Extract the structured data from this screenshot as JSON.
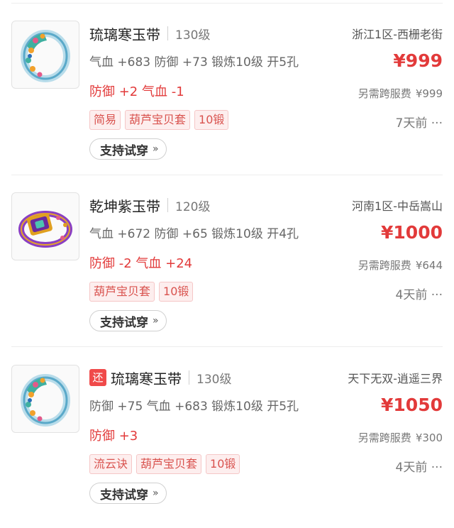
{
  "listings": [
    {
      "return_tag": "",
      "name": "琉璃寒玉带",
      "level": "130级",
      "server": "浙江1区-西栅老街",
      "stats": "气血 +683 防御 +73 锻炼10级 开5孔",
      "price": "¥999",
      "effect": "防御 +2 气血 -1",
      "fee_label": "另需跨服费",
      "fee_amount": "¥999",
      "tags": [
        "简易",
        "葫芦宝贝套",
        "10锻"
      ],
      "time": "7天前",
      "more": "···",
      "try_label": "支持试穿",
      "try_chevron": "»",
      "ring_icon": "blue-jade-ring-icon"
    },
    {
      "return_tag": "",
      "name": "乾坤紫玉带",
      "level": "120级",
      "server": "河南1区-中岳嵩山",
      "stats": "气血 +672 防御 +65 锻炼10级 开4孔",
      "price": "¥1000",
      "effect": "防御 -2 气血 +24",
      "fee_label": "另需跨服费",
      "fee_amount": "¥644",
      "tags": [
        "葫芦宝贝套",
        "10锻"
      ],
      "time": "4天前",
      "more": "···",
      "try_label": "支持试穿",
      "try_chevron": "»",
      "ring_icon": "purple-jade-ring-icon"
    },
    {
      "return_tag": "还",
      "name": "琉璃寒玉带",
      "level": "130级",
      "server": "天下无双-逍遥三界",
      "stats": "防御 +75 气血 +683 锻炼10级 开5孔",
      "price": "¥1050",
      "effect": "防御 +3",
      "fee_label": "另需跨服费",
      "fee_amount": "¥300",
      "tags": [
        "流云诀",
        "葫芦宝贝套",
        "10锻"
      ],
      "time": "4天前",
      "more": "···",
      "try_label": "支持试穿",
      "try_chevron": "»",
      "ring_icon": "blue-jade-ring-icon"
    }
  ],
  "colors": {
    "price": "#e23a3a",
    "tag_text": "#d9534f",
    "tag_bg": "#fdeeee",
    "return_tag": "#f04a4a"
  }
}
